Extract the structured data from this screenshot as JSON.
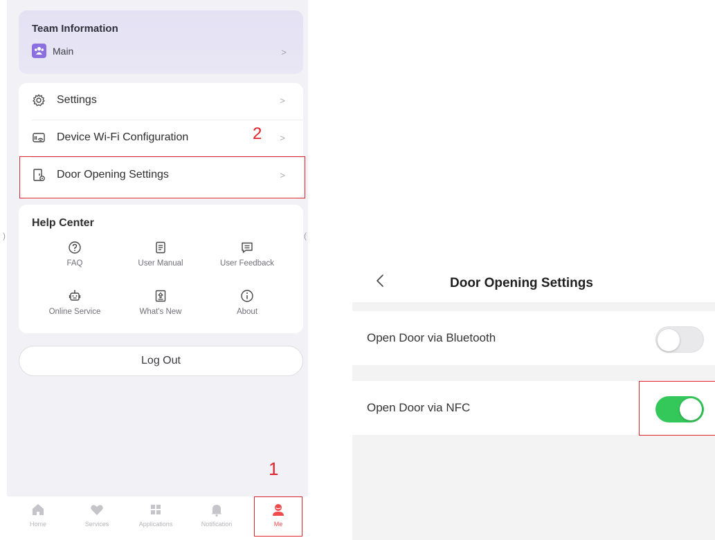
{
  "left": {
    "team": {
      "title": "Team Information",
      "name": "Main",
      "chevron": ">"
    },
    "menu": [
      {
        "label": "Settings",
        "chevron": ">"
      },
      {
        "label": "Device Wi-Fi Configuration",
        "chevron": ">"
      },
      {
        "label": "Door Opening Settings",
        "chevron": ">"
      }
    ],
    "help": {
      "title": "Help Center",
      "items": [
        {
          "label": "FAQ",
          "icon": "faq-icon"
        },
        {
          "label": "User Manual",
          "icon": "manual-icon"
        },
        {
          "label": "User Feedback",
          "icon": "feedback-icon"
        },
        {
          "label": "Online Service",
          "icon": "robot-icon"
        },
        {
          "label": "What's New",
          "icon": "whats-new-icon"
        },
        {
          "label": "About",
          "icon": "info-icon"
        }
      ]
    },
    "logout": "Log Out",
    "tabs": [
      {
        "label": "Home",
        "icon": "home-icon"
      },
      {
        "label": "Services",
        "icon": "heart-icon"
      },
      {
        "label": "Applications",
        "icon": "grid-icon"
      },
      {
        "label": "Notification",
        "icon": "bell-icon"
      },
      {
        "label": "Me",
        "icon": "person-icon",
        "active": true
      }
    ]
  },
  "annotations": {
    "step1": "1",
    "step2": "2"
  },
  "right": {
    "title": "Door Opening Settings",
    "settings": [
      {
        "label": "Open Door via Bluetooth",
        "enabled": false
      },
      {
        "label": "Open Door via NFC",
        "enabled": true
      }
    ]
  },
  "colors": {
    "accent_red": "#e0222a",
    "toggle_on": "#34c759",
    "team_card": "#e5e3f4"
  }
}
